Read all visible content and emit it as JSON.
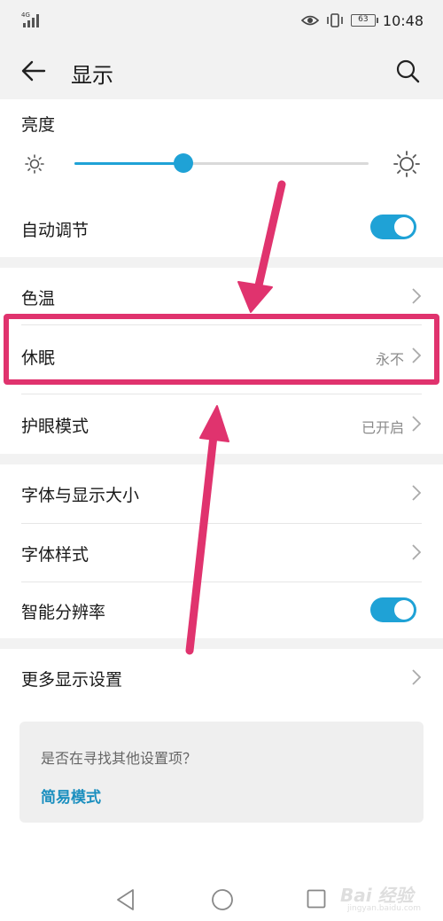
{
  "status_bar": {
    "network": "4G",
    "battery": "63",
    "time": "10:48"
  },
  "app_bar": {
    "title": "显示",
    "back_icon": "arrow-left-icon",
    "search_icon": "search-icon"
  },
  "brightness": {
    "label": "亮度",
    "level": 0.37
  },
  "auto_adjust": {
    "label": "自动调节",
    "enabled": true
  },
  "color_temp": {
    "label": "色温"
  },
  "sleep": {
    "label": "休眠",
    "value": "永不"
  },
  "eye_comfort": {
    "label": "护眼模式",
    "value": "已开启"
  },
  "font_size": {
    "label": "字体与显示大小"
  },
  "font_style": {
    "label": "字体样式"
  },
  "smart_resolution": {
    "label": "智能分辨率",
    "enabled": true
  },
  "more_display": {
    "label": "更多显示设置"
  },
  "hint": {
    "question": "是否在寻找其他设置项？",
    "link": "简易模式"
  },
  "watermark": {
    "text": "Bai 经验",
    "sub": "jingyan.baidu.com"
  },
  "colors": {
    "accent": "#1fa2d6",
    "highlight": "#e0336e",
    "background_gray": "#f2f2f2"
  }
}
